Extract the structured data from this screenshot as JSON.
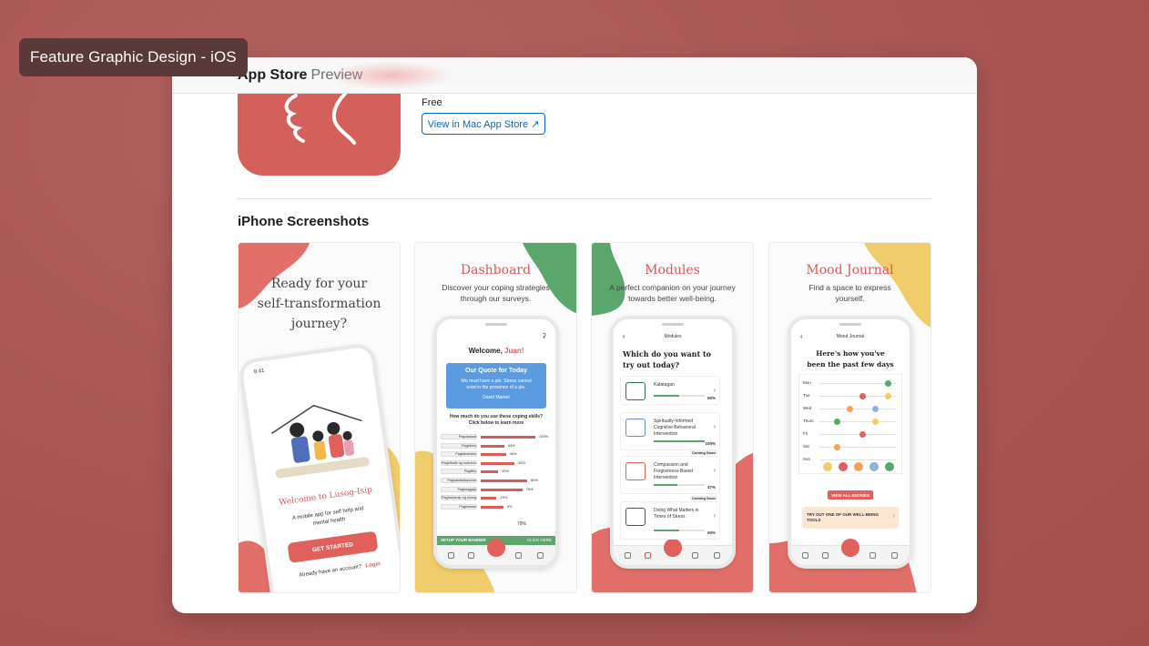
{
  "title_chip": "Feature Graphic Design - iOS",
  "store": {
    "brand": "App Store",
    "preview": "Preview"
  },
  "app": {
    "price": "Free",
    "view_button": "View in Mac App Store ↗"
  },
  "section_title": "iPhone Screenshots",
  "colors": {
    "accent": "#d85b5a",
    "green": "#5aa66d",
    "yellow": "#f0cd6a",
    "link": "#0a66c2",
    "background": "#ad5a58"
  },
  "screenshots": [
    {
      "hero": "Ready for your self-transformation journey?",
      "phone": {
        "time": "9:41",
        "welcome": "Welcome to Lusog-Isip",
        "tagline": "A mobile app for self help and mental health",
        "cta": "GET STARTED",
        "login_prompt": "Already have an account?",
        "login_link": "Login"
      }
    },
    {
      "title": "Dashboard",
      "subtitle": "Discover your coping strategies through our surveys.",
      "phone": {
        "welcome": "Welcome,",
        "name": "Juan!",
        "quote_title": "Our Quote for Today",
        "quote_text": "We must have a pie. Stress cannot exist in the presence of a pie.",
        "quote_author": "David Mamet",
        "question": "How much do you use these coping skills? Click below to learn more",
        "skills": [
          {
            "label": "Pagdarasal",
            "pct": 100,
            "text": "100%"
          },
          {
            "label": "Pagbibiro",
            "pct": 43,
            "text": "43%"
          },
          {
            "label": "Pagtatrabaho",
            "pct": 46,
            "text": "46%"
          },
          {
            "label": "Pagbibalik ng suliranin",
            "pct": 62,
            "text": "62%"
          },
          {
            "label": "Pagtitiis",
            "pct": 32,
            "text": "32%"
          },
          {
            "label": "Pagsasakatuparan",
            "pct": 85,
            "text": "85%"
          },
          {
            "label": "Pagtanggap",
            "pct": 76,
            "text": "76%"
          },
          {
            "label": "Paghahanap ng tulong",
            "pct": 29,
            "text": "29%"
          },
          {
            "label": "Pagiwasan",
            "pct": 41,
            "text": "4%"
          }
        ],
        "gauge": "79%",
        "banner": "SETUP YOUR BANNER",
        "banner_action": "CLICK HERE"
      }
    },
    {
      "title": "Modules",
      "subtitle": "A perfect companion on your journey towards better well-being.",
      "phone": {
        "header": "Modules",
        "question": "Which do you want to try out today?",
        "modules": [
          {
            "name": "Katatagan",
            "progress": 50,
            "text": "50%",
            "badge": ""
          },
          {
            "name": "Spiritually-Informed Cognitive Behavioral Intervention",
            "progress": 100,
            "text": "100%",
            "badge": ""
          },
          {
            "name": "Compassion and Forgiveness-Based Intervention",
            "progress": 47,
            "text": "47%",
            "badge": "Coming Soon"
          },
          {
            "name": "Doing What Matters in Times of Stress",
            "progress": 50,
            "text": "50%",
            "badge": "Coming Soon"
          }
        ]
      }
    },
    {
      "title": "Mood Journal",
      "subtitle": "Find a space to express yourself.",
      "phone": {
        "header": "Mood Journal",
        "question": "Here's how you've been the past few days",
        "days": [
          "Mon",
          "Tue",
          "Wed",
          "Thurs",
          "Fri",
          "Sat",
          "Sun"
        ],
        "view_all": "VIEW ALL ENTRIES",
        "tools": "TRY OUT ONE OF OUR WELL-BEING TOOLS"
      }
    }
  ]
}
